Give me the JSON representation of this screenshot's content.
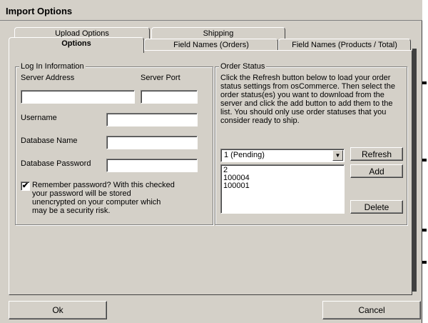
{
  "window": {
    "title": "Import Options",
    "close_glyph": "✕"
  },
  "tabs": {
    "row1": [
      "Upload Options",
      "Shipping"
    ],
    "row2": [
      "Options",
      "Field Names (Orders)",
      "Field Names (Products / Total)"
    ]
  },
  "login": {
    "group_label": "Log In Information",
    "server_address_label": "Server Address",
    "server_port_label": "Server Port",
    "username_label": "Username",
    "database_name_label": "Database Name",
    "database_password_label": "Database Password",
    "server_address_value": "",
    "server_port_value": "",
    "username_value": "",
    "database_name_value": "",
    "database_password_value": "",
    "remember_checked": true,
    "remember_glyph": "✔",
    "remember_text": "Remember password? With this checked your password will be stored unencrypted on your computer which may be a security risk."
  },
  "order_status": {
    "group_label": "Order Status",
    "description": "Click the Refresh button below to load your order status settings from osCommerce. Then select the order status(es) you want to download from the server and click the add button to add them to the list. You should only use order statuses that you consider ready to ship.",
    "selected": "1 (Pending)",
    "dropdown_icon": "triangle-down-icon",
    "list_items": [
      "2",
      "100004",
      "100001"
    ],
    "refresh_label": "Refresh",
    "add_label": "Add",
    "delete_label": "Delete"
  },
  "footer": {
    "ok_label": "Ok",
    "cancel_label": "Cancel"
  }
}
